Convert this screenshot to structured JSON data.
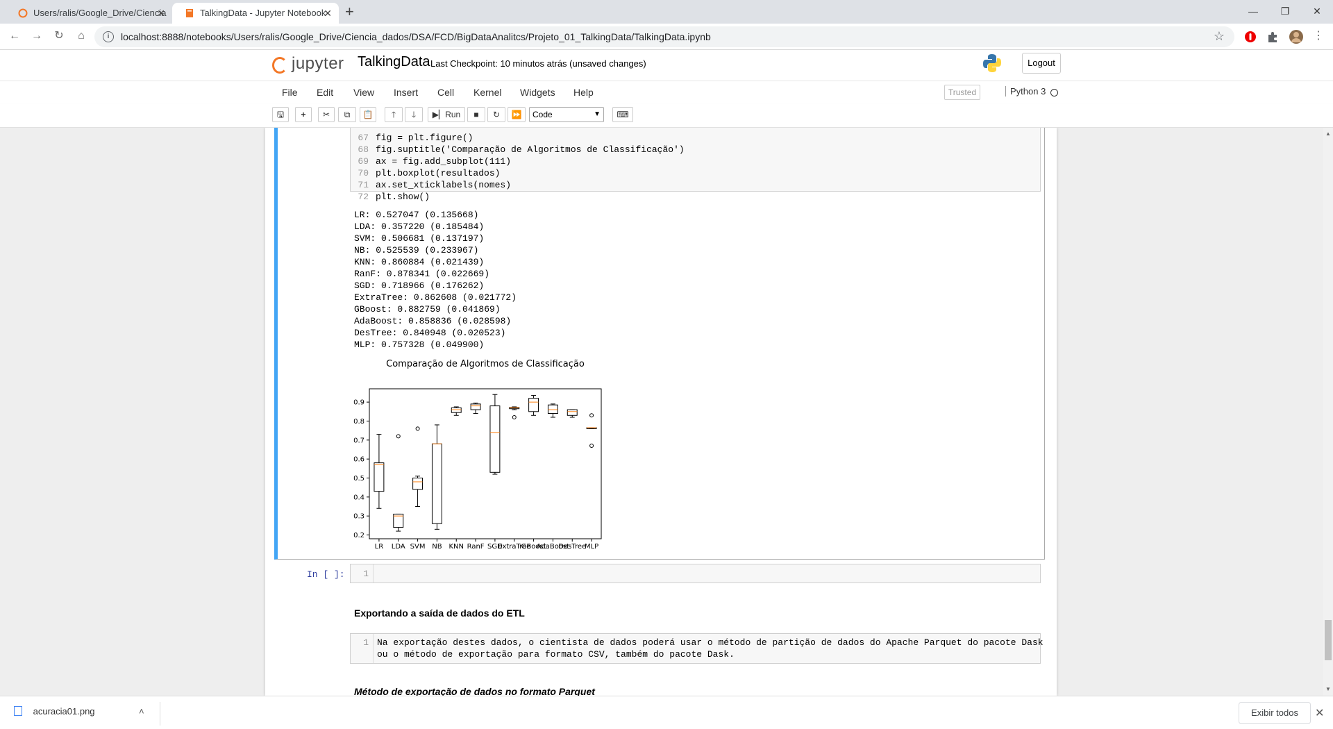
{
  "browser": {
    "tabs": [
      {
        "title": "Users/ralis/Google_Drive/Ciencia",
        "active": false
      },
      {
        "title": "TalkingData - Jupyter Notebook",
        "active": true
      }
    ],
    "url": "localhost:8888/notebooks/Users/ralis/Google_Drive/Ciencia_dados/DSA/FCD/BigDataAnalitcs/Projeto_01_TalkingData/TalkingData.ipynb"
  },
  "jupyter": {
    "logo_text": "jupyter",
    "notebook_name": "TalkingData",
    "checkpoint": "Last Checkpoint: 10 minutos atrás  (unsaved changes)",
    "logout": "Logout",
    "menu": [
      "File",
      "Edit",
      "View",
      "Insert",
      "Cell",
      "Kernel",
      "Widgets",
      "Help"
    ],
    "trusted": "Trusted",
    "kernel": "Python 3",
    "toolbar": {
      "run_label": "Run",
      "cell_type": "Code"
    }
  },
  "code_cell": {
    "lines": [
      {
        "n": "67",
        "text": "fig = plt.figure()"
      },
      {
        "n": "68",
        "text": "fig.suptitle('Comparação de Algoritmos de Classificação')"
      },
      {
        "n": "69",
        "text": "ax = fig.add_subplot(111)"
      },
      {
        "n": "70",
        "text": "plt.boxplot(resultados)"
      },
      {
        "n": "71",
        "text": "ax.set_xticklabels(nomes)"
      },
      {
        "n": "72",
        "text": "plt.show()"
      }
    ]
  },
  "output_lines": [
    "LR: 0.527047 (0.135668)",
    "LDA: 0.357220 (0.185484)",
    "SVM: 0.506681 (0.137197)",
    "NB: 0.525539 (0.233967)",
    "KNN: 0.860884 (0.021439)",
    "RanF: 0.878341 (0.022669)",
    "SGD: 0.718966 (0.176262)",
    "ExtraTree: 0.862608 (0.021772)",
    "GBoost: 0.882759 (0.041869)",
    "AdaBoost: 0.858836 (0.028598)",
    "DesTree: 0.840948 (0.020523)",
    "MLP: 0.757328 (0.049900)"
  ],
  "chart_data": {
    "type": "boxplot",
    "title": "Comparação de Algoritmos de Classificação",
    "categories": [
      "LR",
      "LDA",
      "SVM",
      "NB",
      "KNN",
      "RanF",
      "SGD",
      "ExtraTree",
      "GBoost",
      "AdaBoost",
      "DesTree",
      "MLP"
    ],
    "ylim": [
      0.18,
      0.97
    ],
    "yticks": [
      0.2,
      0.3,
      0.4,
      0.5,
      0.6,
      0.7,
      0.8,
      0.9
    ],
    "boxes": [
      {
        "whislo": 0.34,
        "q1": 0.43,
        "med": 0.57,
        "q3": 0.58,
        "whishi": 0.73,
        "fliers": []
      },
      {
        "whislo": 0.22,
        "q1": 0.24,
        "med": 0.3,
        "q3": 0.31,
        "whishi": 0.31,
        "fliers": [
          0.72
        ]
      },
      {
        "whislo": 0.35,
        "q1": 0.44,
        "med": 0.48,
        "q3": 0.5,
        "whishi": 0.51,
        "fliers": [
          0.76
        ]
      },
      {
        "whislo": 0.23,
        "q1": 0.26,
        "med": 0.68,
        "q3": 0.68,
        "whishi": 0.78,
        "fliers": []
      },
      {
        "whislo": 0.83,
        "q1": 0.845,
        "med": 0.86,
        "q3": 0.87,
        "whishi": 0.875,
        "fliers": []
      },
      {
        "whislo": 0.84,
        "q1": 0.86,
        "med": 0.88,
        "q3": 0.89,
        "whishi": 0.895,
        "fliers": []
      },
      {
        "whislo": 0.52,
        "q1": 0.53,
        "med": 0.74,
        "q3": 0.88,
        "whishi": 0.94,
        "fliers": []
      },
      {
        "whislo": 0.86,
        "q1": 0.865,
        "med": 0.87,
        "q3": 0.872,
        "whishi": 0.875,
        "fliers": [
          0.82
        ]
      },
      {
        "whislo": 0.83,
        "q1": 0.85,
        "med": 0.9,
        "q3": 0.92,
        "whishi": 0.935,
        "fliers": []
      },
      {
        "whislo": 0.82,
        "q1": 0.84,
        "med": 0.86,
        "q3": 0.885,
        "whishi": 0.89,
        "fliers": []
      },
      {
        "whislo": 0.82,
        "q1": 0.83,
        "med": 0.85,
        "q3": 0.86,
        "whishi": 0.86,
        "fliers": []
      },
      {
        "whislo": 0.76,
        "q1": 0.76,
        "med": 0.765,
        "q3": 0.765,
        "whishi": 0.765,
        "fliers": [
          0.83,
          0.67
        ]
      }
    ],
    "box_color": "#000000",
    "median_color": "#ff7f0e",
    "grid": false
  },
  "empty_cell": {
    "prompt": "In [ ]:",
    "line_no": "1"
  },
  "markdown": {
    "heading": "Exportando a saída de dados do ETL",
    "cell_line_no": "1",
    "cell_lines": [
      "Na exportação destes dados, o cientista de dados poderá usar o método de partição de dados do Apache Parquet do pacote Dask",
      "ou o método de exportação para formato CSV, também do pacote Dask."
    ],
    "next_heading": "Método de exportação de dados no formato Parquet"
  },
  "downloads": {
    "file": "acuracia01.png",
    "show_all": "Exibir todos"
  }
}
